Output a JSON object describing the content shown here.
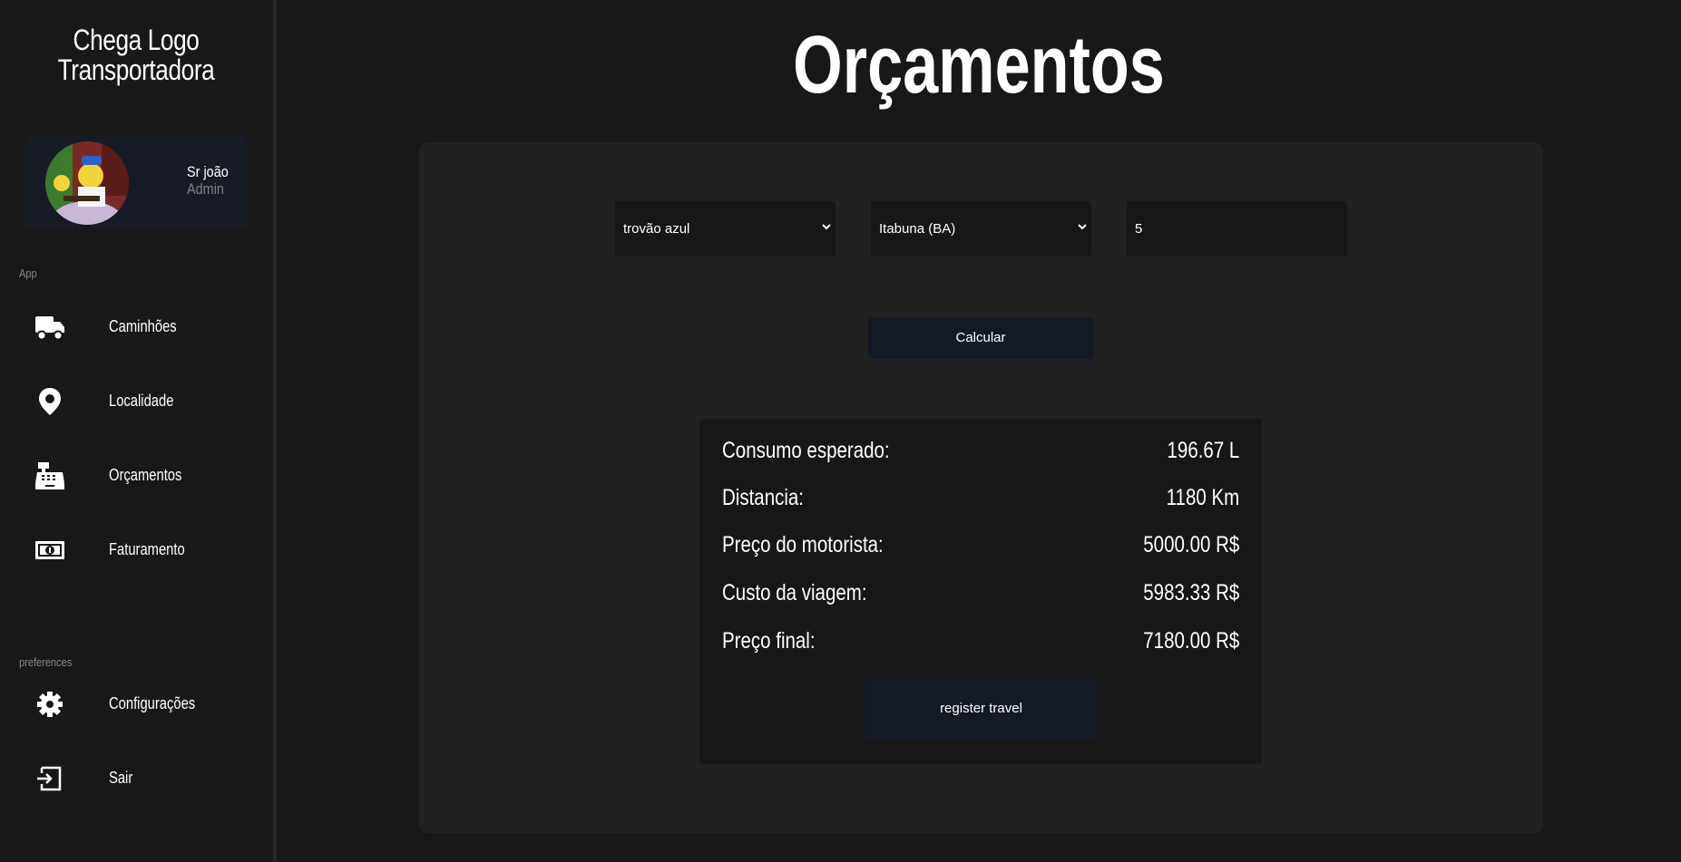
{
  "sidebar": {
    "brand_line1": "Chega Logo",
    "brand_line2": "Transportadora",
    "profile": {
      "name": "Sr joão",
      "role": "Admin"
    },
    "section_app": "App",
    "section_preferences": "preferences",
    "items": [
      {
        "label": "Caminhões",
        "icon": "truck-icon"
      },
      {
        "label": "Localidade",
        "icon": "map-pin-icon"
      },
      {
        "label": "Orçamentos",
        "icon": "cash-register-icon"
      },
      {
        "label": "Faturamento",
        "icon": "money-bill-icon"
      }
    ],
    "pref_items": [
      {
        "label": "Configurações",
        "icon": "gear-icon"
      },
      {
        "label": "Sair",
        "icon": "sign-out-icon"
      }
    ]
  },
  "main": {
    "title": "Orçamentos",
    "truck_select": "trovão azul",
    "location_select": "Itabuna (BA)",
    "quantity_input": "5",
    "calculate_label": "Calcular",
    "results": [
      {
        "label": "Consumo esperado:",
        "value": "196.67 L"
      },
      {
        "label": "Distancia:",
        "value": "1180 Km"
      },
      {
        "label": "Preço do motorista:",
        "value": "5000.00 R$"
      },
      {
        "label": "Custo da viagem:",
        "value": "5983.33 R$"
      },
      {
        "label": "Preço final:",
        "value": "7180.00 R$"
      }
    ],
    "register_label": "register travel"
  }
}
